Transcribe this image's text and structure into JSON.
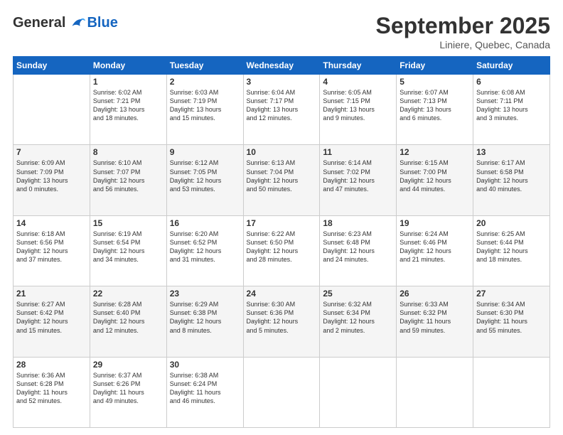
{
  "header": {
    "logo_general": "General",
    "logo_blue": "Blue",
    "month_title": "September 2025",
    "location": "Liniere, Quebec, Canada"
  },
  "weekdays": [
    "Sunday",
    "Monday",
    "Tuesday",
    "Wednesday",
    "Thursday",
    "Friday",
    "Saturday"
  ],
  "weeks": [
    [
      {
        "day": "",
        "info": ""
      },
      {
        "day": "1",
        "info": "Sunrise: 6:02 AM\nSunset: 7:21 PM\nDaylight: 13 hours\nand 18 minutes."
      },
      {
        "day": "2",
        "info": "Sunrise: 6:03 AM\nSunset: 7:19 PM\nDaylight: 13 hours\nand 15 minutes."
      },
      {
        "day": "3",
        "info": "Sunrise: 6:04 AM\nSunset: 7:17 PM\nDaylight: 13 hours\nand 12 minutes."
      },
      {
        "day": "4",
        "info": "Sunrise: 6:05 AM\nSunset: 7:15 PM\nDaylight: 13 hours\nand 9 minutes."
      },
      {
        "day": "5",
        "info": "Sunrise: 6:07 AM\nSunset: 7:13 PM\nDaylight: 13 hours\nand 6 minutes."
      },
      {
        "day": "6",
        "info": "Sunrise: 6:08 AM\nSunset: 7:11 PM\nDaylight: 13 hours\nand 3 minutes."
      }
    ],
    [
      {
        "day": "7",
        "info": "Sunrise: 6:09 AM\nSunset: 7:09 PM\nDaylight: 13 hours\nand 0 minutes."
      },
      {
        "day": "8",
        "info": "Sunrise: 6:10 AM\nSunset: 7:07 PM\nDaylight: 12 hours\nand 56 minutes."
      },
      {
        "day": "9",
        "info": "Sunrise: 6:12 AM\nSunset: 7:05 PM\nDaylight: 12 hours\nand 53 minutes."
      },
      {
        "day": "10",
        "info": "Sunrise: 6:13 AM\nSunset: 7:04 PM\nDaylight: 12 hours\nand 50 minutes."
      },
      {
        "day": "11",
        "info": "Sunrise: 6:14 AM\nSunset: 7:02 PM\nDaylight: 12 hours\nand 47 minutes."
      },
      {
        "day": "12",
        "info": "Sunrise: 6:15 AM\nSunset: 7:00 PM\nDaylight: 12 hours\nand 44 minutes."
      },
      {
        "day": "13",
        "info": "Sunrise: 6:17 AM\nSunset: 6:58 PM\nDaylight: 12 hours\nand 40 minutes."
      }
    ],
    [
      {
        "day": "14",
        "info": "Sunrise: 6:18 AM\nSunset: 6:56 PM\nDaylight: 12 hours\nand 37 minutes."
      },
      {
        "day": "15",
        "info": "Sunrise: 6:19 AM\nSunset: 6:54 PM\nDaylight: 12 hours\nand 34 minutes."
      },
      {
        "day": "16",
        "info": "Sunrise: 6:20 AM\nSunset: 6:52 PM\nDaylight: 12 hours\nand 31 minutes."
      },
      {
        "day": "17",
        "info": "Sunrise: 6:22 AM\nSunset: 6:50 PM\nDaylight: 12 hours\nand 28 minutes."
      },
      {
        "day": "18",
        "info": "Sunrise: 6:23 AM\nSunset: 6:48 PM\nDaylight: 12 hours\nand 24 minutes."
      },
      {
        "day": "19",
        "info": "Sunrise: 6:24 AM\nSunset: 6:46 PM\nDaylight: 12 hours\nand 21 minutes."
      },
      {
        "day": "20",
        "info": "Sunrise: 6:25 AM\nSunset: 6:44 PM\nDaylight: 12 hours\nand 18 minutes."
      }
    ],
    [
      {
        "day": "21",
        "info": "Sunrise: 6:27 AM\nSunset: 6:42 PM\nDaylight: 12 hours\nand 15 minutes."
      },
      {
        "day": "22",
        "info": "Sunrise: 6:28 AM\nSunset: 6:40 PM\nDaylight: 12 hours\nand 12 minutes."
      },
      {
        "day": "23",
        "info": "Sunrise: 6:29 AM\nSunset: 6:38 PM\nDaylight: 12 hours\nand 8 minutes."
      },
      {
        "day": "24",
        "info": "Sunrise: 6:30 AM\nSunset: 6:36 PM\nDaylight: 12 hours\nand 5 minutes."
      },
      {
        "day": "25",
        "info": "Sunrise: 6:32 AM\nSunset: 6:34 PM\nDaylight: 12 hours\nand 2 minutes."
      },
      {
        "day": "26",
        "info": "Sunrise: 6:33 AM\nSunset: 6:32 PM\nDaylight: 11 hours\nand 59 minutes."
      },
      {
        "day": "27",
        "info": "Sunrise: 6:34 AM\nSunset: 6:30 PM\nDaylight: 11 hours\nand 55 minutes."
      }
    ],
    [
      {
        "day": "28",
        "info": "Sunrise: 6:36 AM\nSunset: 6:28 PM\nDaylight: 11 hours\nand 52 minutes."
      },
      {
        "day": "29",
        "info": "Sunrise: 6:37 AM\nSunset: 6:26 PM\nDaylight: 11 hours\nand 49 minutes."
      },
      {
        "day": "30",
        "info": "Sunrise: 6:38 AM\nSunset: 6:24 PM\nDaylight: 11 hours\nand 46 minutes."
      },
      {
        "day": "",
        "info": ""
      },
      {
        "day": "",
        "info": ""
      },
      {
        "day": "",
        "info": ""
      },
      {
        "day": "",
        "info": ""
      }
    ]
  ]
}
